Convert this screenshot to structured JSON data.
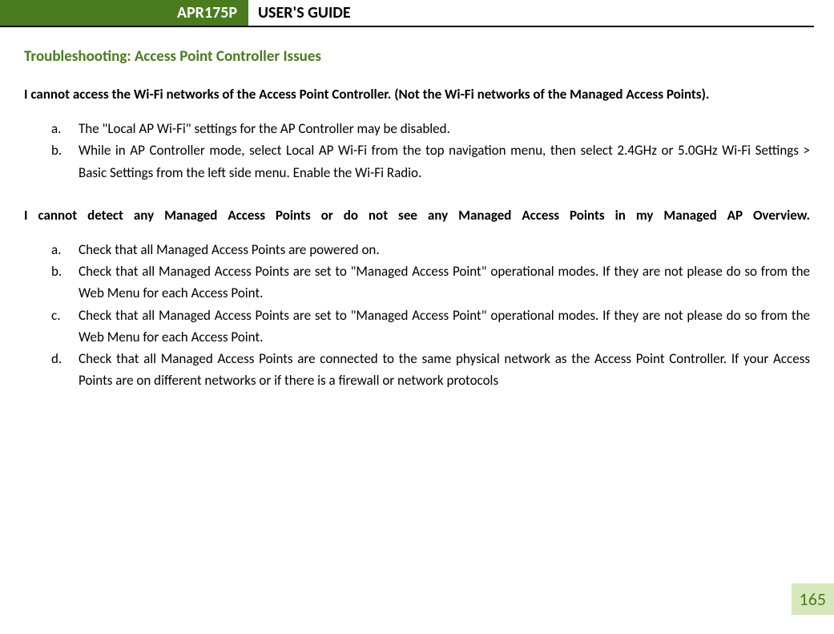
{
  "header": {
    "tab": "APR175P",
    "title": "USER'S GUIDE"
  },
  "section_heading": "Troubleshooting: Access Point Controller Issues",
  "issues": [
    {
      "title": "I cannot access the Wi-Fi networks of the Access Point Controller.  (Not the Wi-Fi networks of the Managed Access Points).",
      "items": [
        {
          "marker": "a.",
          "text": "The \"Local AP Wi-Fi\" settings for the AP Controller may be disabled."
        },
        {
          "marker": "b.",
          "text": "While in AP Controller mode, select Local AP Wi-Fi from the top navigation menu, then select 2.4GHz or 5.0GHz Wi-Fi Settings > Basic Settings from the left side menu.  Enable the Wi-Fi Radio."
        }
      ]
    },
    {
      "title": "I cannot detect any Managed Access Points or do not see any Managed Access Points in my Managed AP Overview.",
      "items": [
        {
          "marker": "a.",
          "text": "Check that all Managed Access Points are powered on."
        },
        {
          "marker": "b.",
          "text": "Check that all Managed Access Points are set to \"Managed Access Point\" operational modes. If they are not please do so from the Web Menu for each Access Point."
        },
        {
          "marker": "c.",
          "text": "Check that all Managed Access Points are set to \"Managed Access Point\" operational modes. If they are not please do so from the Web Menu for each Access Point."
        },
        {
          "marker": "d.",
          "text": "Check that all Managed Access Points are connected to the same physical network as the Access Point Controller. If your Access Points are on different networks or if there is a firewall or network protocols"
        }
      ]
    }
  ],
  "page_number": "165"
}
